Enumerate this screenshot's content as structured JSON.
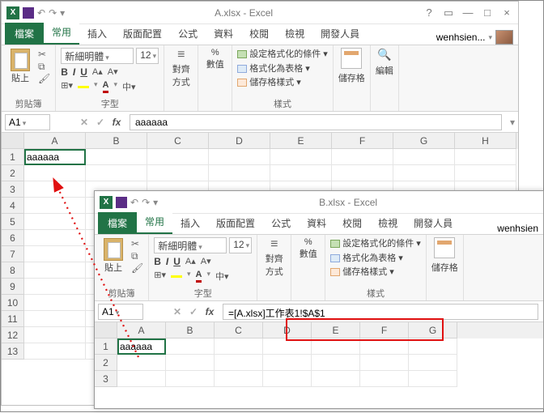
{
  "winA": {
    "title": "A.xlsx - Excel",
    "tabs": {
      "file": "檔案",
      "home": "常用",
      "insert": "插入",
      "layout": "版面配置",
      "formula": "公式",
      "data": "資料",
      "review": "校閱",
      "view": "檢視",
      "dev": "開發人員",
      "user": "wenhsien..."
    },
    "ribbon": {
      "clipboard_label": "剪貼簿",
      "paste": "貼上",
      "font_label": "字型",
      "font_name": "新細明體",
      "font_size": "12",
      "align_label": "對齊方式",
      "align_btn": "對齊方式",
      "number_label": "數值",
      "number_btn": "數值",
      "styles_label": "樣式",
      "cond": "設定格式化的條件",
      "table": "格式化為表格",
      "cellstyle": "儲存格樣式",
      "cells_label": "儲存格",
      "cells_btn": "儲存格",
      "edit_label": "編輯",
      "edit_btn": "編輯"
    },
    "namebox": "A1",
    "formula": "aaaaaa",
    "cols": [
      "A",
      "B",
      "C",
      "D",
      "E",
      "F",
      "G",
      "H"
    ],
    "rows": [
      "1",
      "2",
      "3",
      "4",
      "5",
      "6",
      "7",
      "8",
      "9",
      "10",
      "11",
      "12",
      "13"
    ],
    "A1": "aaaaaa"
  },
  "winB": {
    "title": "B.xlsx - Excel",
    "tabs": {
      "file": "檔案",
      "home": "常用",
      "insert": "插入",
      "layout": "版面配置",
      "formula": "公式",
      "data": "資料",
      "review": "校閱",
      "view": "檢視",
      "dev": "開發人員",
      "user": "wenhsien"
    },
    "ribbon": {
      "clipboard_label": "剪貼簿",
      "paste": "貼上",
      "font_label": "字型",
      "font_name": "新細明體",
      "font_size": "12",
      "align_label": "對齊方式",
      "align_btn": "對齊方式",
      "number_label": "數值",
      "number_btn": "數值",
      "styles_label": "樣式",
      "cond": "設定格式化的條件",
      "table": "格式化為表格",
      "cellstyle": "儲存格樣式",
      "cells_label": "儲存格",
      "cells_btn": "儲存格"
    },
    "namebox": "A1",
    "formula": "=[A.xlsx]工作表1!$A$1",
    "cols": [
      "A",
      "B",
      "C",
      "D",
      "E",
      "F",
      "G"
    ],
    "rows": [
      "1",
      "2",
      "3"
    ],
    "A1": "aaaaaa"
  }
}
